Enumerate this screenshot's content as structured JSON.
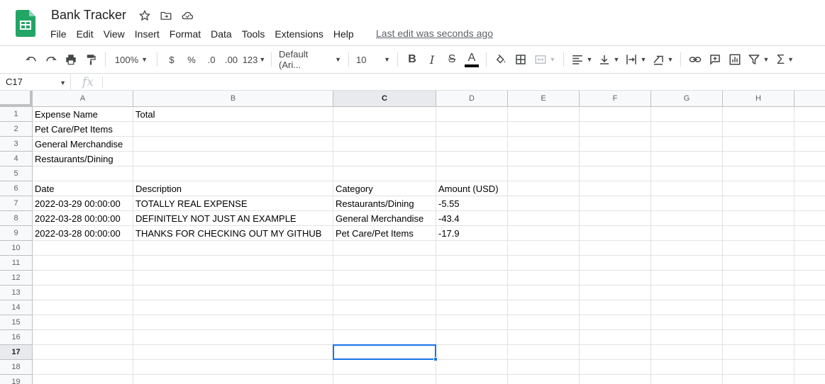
{
  "app": {
    "title": "Bank Tracker",
    "last_edit": "Last edit was seconds ago",
    "brand_color": "#23A566"
  },
  "menu": [
    "File",
    "Edit",
    "View",
    "Insert",
    "Format",
    "Data",
    "Tools",
    "Extensions",
    "Help"
  ],
  "toolbar": {
    "zoom": "100%",
    "currency": "$",
    "percent": "%",
    "dec_less": ".0",
    "dec_more": ".00",
    "more_formats": "123",
    "font": "Default (Ari...",
    "font_size": "10"
  },
  "formula_bar": {
    "name_box": "C17",
    "fx": "fx"
  },
  "grid": {
    "columns": [
      "A",
      "B",
      "C",
      "D",
      "E",
      "F",
      "G",
      "H"
    ],
    "rows": [
      "1",
      "2",
      "3",
      "4",
      "5",
      "6",
      "7",
      "8",
      "9",
      "10",
      "11",
      "12",
      "13",
      "14",
      "15",
      "16",
      "17",
      "18",
      "19"
    ],
    "selected_col": "C",
    "selected_row": "17",
    "cells": [
      [
        "Expense Name",
        "Total",
        "",
        "",
        "",
        "",
        "",
        ""
      ],
      [
        "Pet Care/Pet Items",
        "",
        "",
        "",
        "",
        "",
        "",
        ""
      ],
      [
        "General Merchandise",
        "",
        "",
        "",
        "",
        "",
        "",
        ""
      ],
      [
        "Restaurants/Dining",
        "",
        "",
        "",
        "",
        "",
        "",
        ""
      ],
      [
        "",
        "",
        "",
        "",
        "",
        "",
        "",
        ""
      ],
      [
        "Date",
        "Description",
        "Category",
        "Amount (USD)",
        "",
        "",
        "",
        ""
      ],
      [
        "2022-03-29 00:00:00",
        "TOTALLY REAL EXPENSE",
        "Restaurants/Dining",
        "-5.55",
        "",
        "",
        "",
        ""
      ],
      [
        "2022-03-28 00:00:00",
        "DEFINITELY NOT JUST AN EXAMPLE",
        "General Merchandise",
        "-43.4",
        "",
        "",
        "",
        ""
      ],
      [
        "2022-03-28 00:00:00",
        "THANKS FOR CHECKING OUT MY GITHUB",
        "Pet Care/Pet Items",
        "-17.9",
        "",
        "",
        "",
        ""
      ]
    ]
  }
}
